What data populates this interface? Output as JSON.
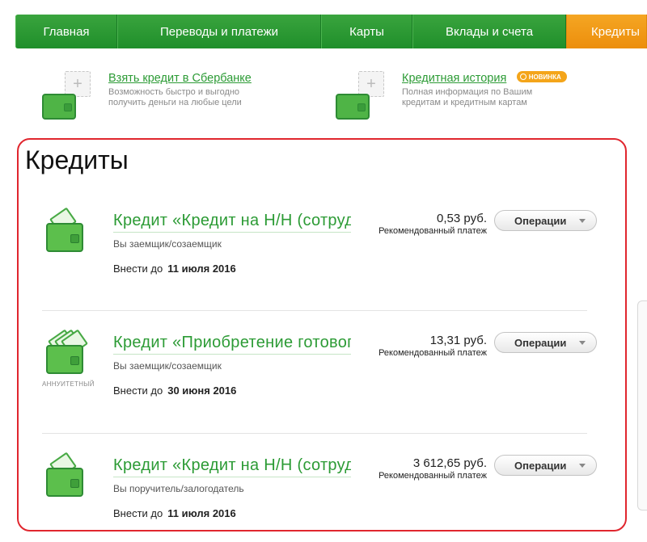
{
  "nav": {
    "items": [
      "Главная",
      "Переводы и платежи",
      "Карты",
      "Вклады и счета",
      "Кредиты"
    ],
    "active_index": 4
  },
  "promos": [
    {
      "title": "Взять кредит в Сбербанке",
      "desc_line1": "Возможность быстро и выгодно",
      "desc_line2": "получить деньги на любые цели",
      "badge": ""
    },
    {
      "title": "Кредитная история",
      "desc_line1": "Полная информация по Вашим",
      "desc_line2": "кредитам и кредитным картам",
      "badge": "НОВИНКА"
    }
  ],
  "section_title": "Кредиты",
  "credits": [
    {
      "name": "Кредит «Кредит на Н/Н (сотрудникам)»",
      "role": "Вы заемщик/созаемщик",
      "due_label": "Внести до",
      "due_date": "11 июля 2016",
      "amount": "0,53 руб.",
      "amount_label": "Рекомендованный платеж",
      "ops_label": "Операции",
      "type_label": ""
    },
    {
      "name": "Кредит «Приобретение готового жилья»",
      "role": "Вы заемщик/созаемщик",
      "due_label": "Внести до",
      "due_date": "30 июня 2016",
      "amount": "13,31 руб.",
      "amount_label": "Рекомендованный платеж",
      "ops_label": "Операции",
      "type_label": "АННУИТЕТНЫЙ"
    },
    {
      "name": "Кредит «Кредит на Н/Н (сотрудникам)»",
      "role": "Вы поручитель/залогодатель",
      "due_label": "Внести до",
      "due_date": "11 июля 2016",
      "amount": "3 612,65 руб.",
      "amount_label": "Рекомендованный платеж",
      "ops_label": "Операции",
      "type_label": ""
    }
  ],
  "colors": {
    "nav_green": "#2a9a33",
    "nav_active": "#f19b18",
    "link_green": "#2c9b35",
    "highlight_red": "#e0262e",
    "badge_orange": "#f4a51a"
  }
}
